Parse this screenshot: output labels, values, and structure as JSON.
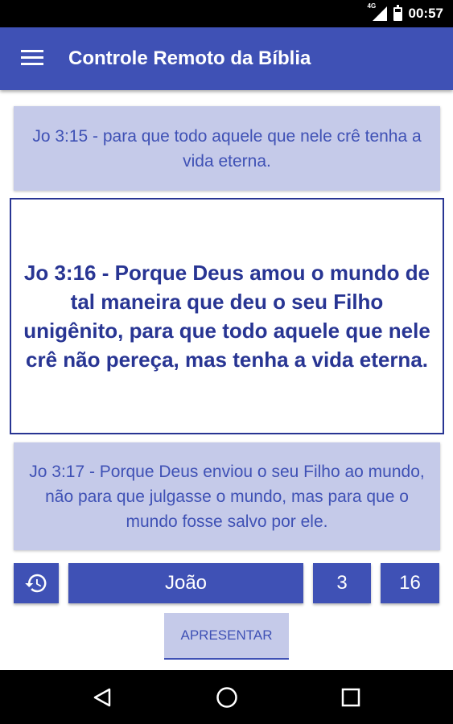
{
  "status_bar": {
    "network": "4G",
    "time": "00:57"
  },
  "app_bar": {
    "title": "Controle Remoto da Bíblia"
  },
  "verses": {
    "previous": "Jo 3:15 - para que todo aquele que nele crê tenha a vida eterna.",
    "current": "Jo 3:16 - Porque Deus amou o mundo de tal maneira que deu o seu Filho unigênito, para que todo aquele que nele crê não pereça, mas tenha a vida eterna.",
    "next": "Jo 3:17 - Porque Deus enviou o seu Filho ao mundo, não para que julgasse o mundo, mas para que o mundo fosse salvo por ele."
  },
  "controls": {
    "book": "João",
    "chapter": "3",
    "verse": "16",
    "present_label": "APRESENTAR"
  },
  "icons": {
    "menu": "menu-icon",
    "history": "history-icon",
    "back": "back-icon",
    "home": "home-icon",
    "recents": "recents-icon"
  },
  "colors": {
    "primary": "#3f51b5",
    "primary_dark": "#283593",
    "light": "#c5cae9"
  }
}
